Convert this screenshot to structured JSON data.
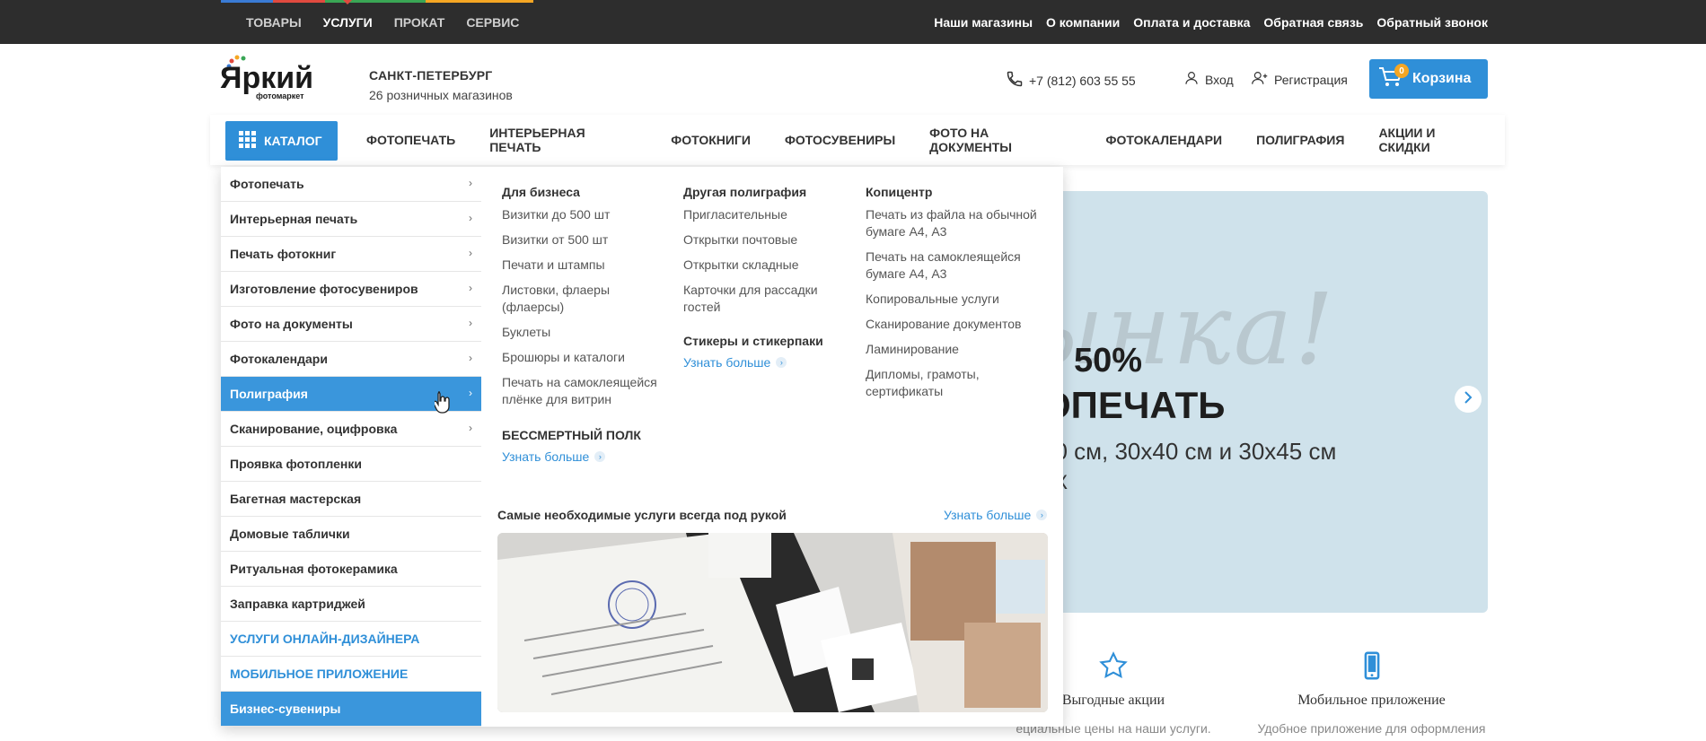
{
  "topbar": {
    "nav": [
      {
        "label": "ТОВАРЫ",
        "active": false
      },
      {
        "label": "УСЛУГИ",
        "active": true
      },
      {
        "label": "ПРОКАТ",
        "active": false
      },
      {
        "label": "СЕРВИС",
        "active": false
      }
    ],
    "links": [
      "Наши магазины",
      "О компании",
      "Оплата и доставка",
      "Обратная связь",
      "Обратный звонок"
    ],
    "accent_colors": [
      "#3a7bd5",
      "#e04a3f",
      "#3aa655",
      "#f5a623"
    ]
  },
  "header": {
    "logo_text": "Яркий",
    "logo_sub": "фотомаркет",
    "city": "САНКТ-ПЕТЕРБУРГ",
    "stores": "26 розничных магазинов",
    "phone": "+7 (812) 603 55 55",
    "login": "Вход",
    "register": "Регистрация",
    "cart_label": "Корзина",
    "cart_count": "0"
  },
  "mainnav": {
    "catalog": "КАТАЛОГ",
    "items": [
      "ФОТОПЕЧАТЬ",
      "ИНТЕРЬЕРНАЯ ПЕЧАТЬ",
      "ФОТОКНИГИ",
      "ФОТОСУВЕНИРЫ",
      "ФОТО НА ДОКУМЕНТЫ",
      "ФОТОКАЛЕНДАРИ",
      "ПОЛИГРАФИЯ",
      "АКЦИИ И СКИДКИ"
    ]
  },
  "hero": {
    "script": "ынка!",
    "line1": "50%",
    "line2": "ОПЕЧАТЬ",
    "line3": "30 см, 30x40 см и 30x45 см",
    "line4": "ИК"
  },
  "features": [
    {
      "title": "Выгодные акции",
      "desc": "ециальные цены на наши услуги."
    },
    {
      "title": "Мобильное приложение",
      "desc": "Удобное приложение для оформления"
    }
  ],
  "menu": {
    "categories": [
      {
        "label": "Фотопечать",
        "chev": true,
        "state": "normal"
      },
      {
        "label": "Интерьерная печать",
        "chev": true,
        "state": "normal"
      },
      {
        "label": "Печать фотокниг",
        "chev": true,
        "state": "normal"
      },
      {
        "label": "Изготовление фотосувениров",
        "chev": true,
        "state": "normal"
      },
      {
        "label": "Фото на документы",
        "chev": true,
        "state": "normal"
      },
      {
        "label": "Фотокалендари",
        "chev": true,
        "state": "normal"
      },
      {
        "label": "Полиграфия",
        "chev": true,
        "state": "active"
      },
      {
        "label": "Сканирование, оцифровка",
        "chev": true,
        "state": "normal"
      },
      {
        "label": "Проявка фотопленки",
        "chev": false,
        "state": "normal"
      },
      {
        "label": "Багетная мастерская",
        "chev": false,
        "state": "normal"
      },
      {
        "label": "Домовые таблички",
        "chev": false,
        "state": "normal"
      },
      {
        "label": "Ритуальная фотокерамика",
        "chev": false,
        "state": "normal"
      },
      {
        "label": "Заправка картриджей",
        "chev": false,
        "state": "normal"
      },
      {
        "label": "УСЛУГИ ОНЛАЙН-ДИЗАЙНЕРА",
        "chev": false,
        "state": "link"
      },
      {
        "label": "МОБИЛЬНОЕ ПРИЛОЖЕНИЕ",
        "chev": false,
        "state": "link"
      },
      {
        "label": "Бизнес-сувениры",
        "chev": false,
        "state": "blue"
      }
    ],
    "col1": {
      "title": "Для бизнеса",
      "items": [
        "Визитки до 500 шт",
        "Визитки от 500 шт",
        "Печати и штампы",
        "Листовки, флаеры (флаерсы)",
        "Буклеты",
        "Брошюры и каталоги",
        "Печать на самоклеящейся плёнке для витрин"
      ],
      "sub_title": "БЕССМЕРТНЫЙ ПОЛК",
      "sub_more": "Узнать больше"
    },
    "col2": {
      "title": "Другая полиграфия",
      "items": [
        "Пригласительные",
        "Открытки почтовые",
        "Открытки складные",
        "Карточки для рассадки гостей"
      ],
      "sub_title": "Стикеры и стикерпаки",
      "sub_more": "Узнать больше"
    },
    "col3": {
      "title": "Копицентр",
      "items": [
        "Печать из файла на обычной бумаге А4, А3",
        "Печать на самоклеящейся бумаге А4, А3",
        "Копировальные услуги",
        "Сканирование документов",
        "Ламинирование",
        "Дипломы, грамоты, сертификаты"
      ]
    },
    "promo": {
      "title": "Самые необходимые услуги всегда под рукой",
      "more": "Узнать больше"
    }
  }
}
